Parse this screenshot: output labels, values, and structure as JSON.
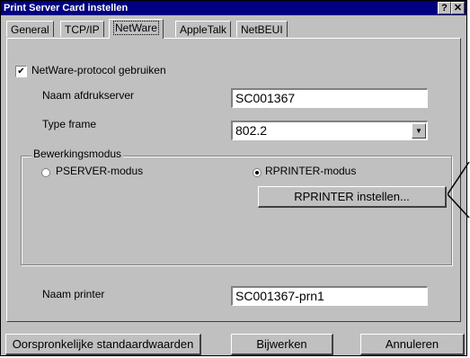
{
  "window": {
    "title": "Print Server Card instellen",
    "help_label": "?",
    "close_label": "✕"
  },
  "tabs": [
    {
      "label": "General",
      "active": false
    },
    {
      "label": "TCP/IP",
      "active": false
    },
    {
      "label": "NetWare",
      "active": true
    },
    {
      "label": "AppleTalk",
      "active": false
    },
    {
      "label": "NetBEUI",
      "active": false
    }
  ],
  "netware": {
    "use_protocol_label": "NetWare-protocol gebruiken",
    "use_protocol_checked": true,
    "print_server_name_label": "Naam afdrukserver",
    "print_server_name_value": "SC001367",
    "frame_type_label": "Type frame",
    "frame_type_value": "802.2",
    "mode_group_label": "Bewerkingsmodus",
    "pserver_label": "PSERVER-modus",
    "rprinter_label": "RPRINTER-modus",
    "selected_mode": "rprinter",
    "rprinter_settings_button": "RPRINTER instellen...",
    "printer_name_label": "Naam printer",
    "printer_name_value": "SC001367-prn1"
  },
  "footer": {
    "defaults_button": "Oorspronkelijke standaardwaarden",
    "update_button": "Bijwerken",
    "cancel_button": "Annuleren"
  },
  "icons": {
    "checkbox_check": "check-icon",
    "dropdown": "chevron-down-icon",
    "callout": "callout-pointer-icon"
  }
}
